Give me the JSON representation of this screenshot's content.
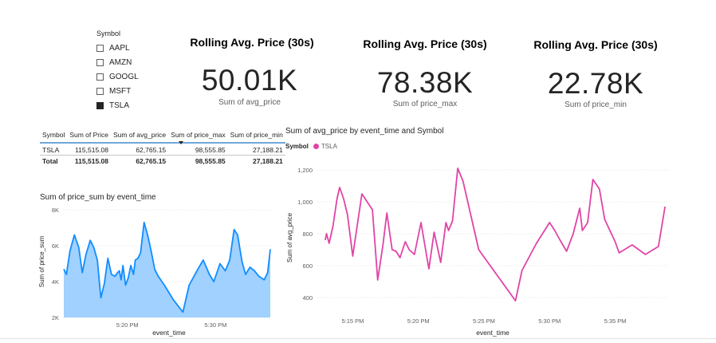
{
  "slicer": {
    "title": "Symbol",
    "items": [
      {
        "label": "AAPL",
        "checked": false
      },
      {
        "label": "AMZN",
        "checked": false
      },
      {
        "label": "GOOGL",
        "checked": false
      },
      {
        "label": "MSFT",
        "checked": false
      },
      {
        "label": "TSLA",
        "checked": true
      }
    ]
  },
  "kpis": [
    {
      "title": "Rolling Avg. Price (30s)",
      "value": "50.01K",
      "label": "Sum of avg_price"
    },
    {
      "title": "Rolling Avg. Price (30s)",
      "value": "78.38K",
      "label": "Sum of price_max"
    },
    {
      "title": "Rolling Avg. Price (30s)",
      "value": "22.78K",
      "label": "Sum of price_min"
    }
  ],
  "table": {
    "headers": [
      "Symbol",
      "Sum of Price",
      "Sum of avg_price",
      "Sum of price_max",
      "Sum of price_min"
    ],
    "rows": [
      [
        "TSLA",
        "115,515.08",
        "62,765.15",
        "98,555.85",
        "27,188.21"
      ]
    ],
    "total": [
      "Total",
      "115,515.08",
      "62,765.15",
      "98,555.85",
      "27,188.21"
    ]
  },
  "chart_data": [
    {
      "type": "area",
      "title": "Sum of price_sum by event_time",
      "xlabel": "event_time",
      "ylabel": "Sum of price_sum",
      "ylim": [
        2000,
        8000
      ],
      "y_ticks": [
        2000,
        4000,
        6000,
        8000
      ],
      "y_tick_labels": [
        "2K",
        "4K",
        "6K",
        "8K"
      ],
      "x_ticks": [
        "5:20 PM",
        "5:30 PM"
      ],
      "x_tick_minutes": [
        20,
        30
      ],
      "xlim_minutes": [
        12.8,
        36.2
      ],
      "grid": true,
      "color": "#118dff",
      "fill": "#a0d1ff",
      "series": [
        {
          "x_minutes": [
            12.8,
            13.1,
            13.5,
            14.0,
            14.5,
            14.9,
            15.3,
            15.8,
            16.2,
            16.6,
            17.0,
            17.4,
            17.8,
            18.2,
            18.6,
            18.9,
            19.1,
            19.3,
            19.5,
            19.8,
            20.1,
            20.4,
            20.7,
            20.9,
            21.2,
            21.5,
            21.9,
            22.3,
            22.7,
            23.1,
            23.5,
            24.2,
            25.2,
            26.3,
            27.0,
            28.0,
            28.6,
            29.3,
            29.8,
            30.5,
            31.1,
            31.6,
            32.1,
            32.5,
            33.0,
            33.4,
            33.9,
            34.4,
            34.9,
            35.5,
            35.9,
            36.2
          ],
          "values": [
            4700,
            4400,
            5700,
            6600,
            5900,
            4500,
            5500,
            6300,
            5900,
            5200,
            3100,
            3900,
            5300,
            4400,
            4300,
            4500,
            4600,
            4100,
            4900,
            3800,
            4200,
            4900,
            4400,
            5200,
            5300,
            5600,
            7300,
            6600,
            5700,
            4700,
            4300,
            3800,
            3000,
            2300,
            3800,
            4700,
            5200,
            4400,
            4000,
            5000,
            4600,
            5200,
            6900,
            6600,
            5100,
            4400,
            4800,
            4600,
            4300,
            4100,
            4500,
            5800
          ]
        }
      ]
    },
    {
      "type": "line",
      "title": "Sum of avg_price by event_time and Symbol",
      "xlabel": "event_time",
      "ylabel": "Sum of avg_price",
      "ylim": [
        300,
        1250
      ],
      "y_ticks": [
        400,
        600,
        800,
        1000,
        1200
      ],
      "y_tick_labels": [
        "400",
        "600",
        "800",
        "1,000",
        "1,200"
      ],
      "x_ticks": [
        "5:15 PM",
        "5:20 PM",
        "5:25 PM",
        "5:30 PM",
        "5:35 PM"
      ],
      "x_tick_minutes": [
        15,
        20,
        25,
        30,
        35
      ],
      "xlim_minutes": [
        12.3,
        39.1
      ],
      "grid": true,
      "legend": {
        "title": "Symbol",
        "position": "top-left"
      },
      "series": [
        {
          "name": "TSLA",
          "color": "#e044a7",
          "x_minutes": [
            12.9,
            13.0,
            13.2,
            13.5,
            13.8,
            14.0,
            14.3,
            14.6,
            15.0,
            15.3,
            15.7,
            16.1,
            16.5,
            16.9,
            17.3,
            17.6,
            18.0,
            18.3,
            18.6,
            19.0,
            19.3,
            19.7,
            20.2,
            20.8,
            21.2,
            21.7,
            22.1,
            22.3,
            22.6,
            23.0,
            23.4,
            24.6,
            27.4,
            27.9,
            29.0,
            30.0,
            30.4,
            30.8,
            31.3,
            31.8,
            32.3,
            32.5,
            32.9,
            33.3,
            33.8,
            34.2,
            35.0,
            35.3,
            36.3,
            37.3,
            38.3,
            38.8
          ],
          "values": [
            760,
            800,
            740,
            850,
            1020,
            1090,
            1020,
            920,
            660,
            830,
            1050,
            1000,
            950,
            510,
            730,
            930,
            700,
            690,
            650,
            750,
            700,
            670,
            870,
            580,
            810,
            620,
            870,
            820,
            880,
            1210,
            1130,
            700,
            380,
            570,
            740,
            870,
            820,
            760,
            690,
            800,
            960,
            820,
            870,
            1140,
            1080,
            890,
            750,
            680,
            730,
            670,
            720,
            970
          ]
        }
      ]
    }
  ]
}
